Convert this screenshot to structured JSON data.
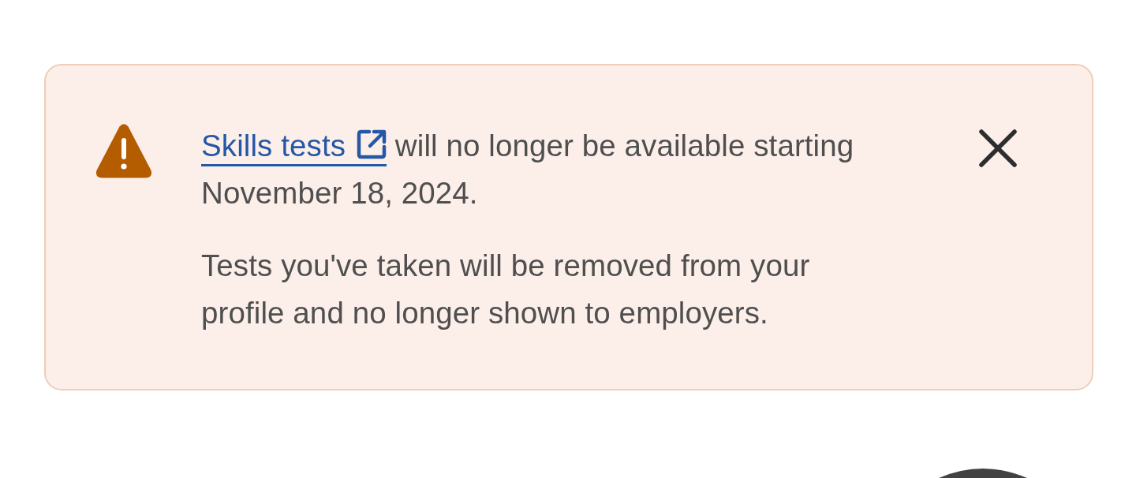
{
  "alert": {
    "link": "Skills tests",
    "message": " will no longer be available starting November 18, 2024.",
    "detail": "Tests you've taken will be removed from your profile and no longer shown to employers.",
    "dismissible": true
  }
}
